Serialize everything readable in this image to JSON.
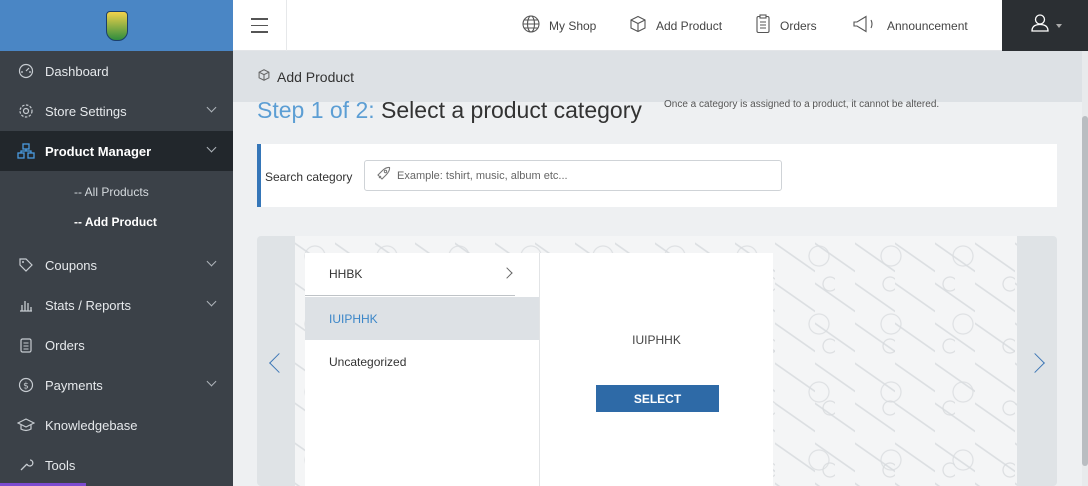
{
  "sidebar": {
    "items": [
      {
        "label": "Dashboard",
        "icon": "dashboard-icon",
        "has_children": false
      },
      {
        "label": "Store Settings",
        "icon": "gear-icon",
        "has_children": true
      },
      {
        "label": "Product Manager",
        "icon": "sitemap-icon",
        "has_children": true,
        "active": true,
        "children": [
          {
            "label": "-- All Products"
          },
          {
            "label": "-- Add Product",
            "current": true
          }
        ]
      },
      {
        "label": "Coupons",
        "icon": "tag-icon",
        "has_children": true
      },
      {
        "label": "Stats / Reports",
        "icon": "bar-chart-icon",
        "has_children": true
      },
      {
        "label": "Orders",
        "icon": "clipboard-icon",
        "has_children": false
      },
      {
        "label": "Payments",
        "icon": "dollar-icon",
        "has_children": true
      },
      {
        "label": "Knowledgebase",
        "icon": "graduation-cap-icon",
        "has_children": false
      },
      {
        "label": "Tools",
        "icon": "wrench-icon",
        "has_children": false
      }
    ]
  },
  "topbar": {
    "links": [
      {
        "label": "My Shop",
        "icon": "globe-icon"
      },
      {
        "label": "Add Product",
        "icon": "cube-icon"
      },
      {
        "label": "Orders",
        "icon": "clipboard-icon"
      },
      {
        "label": "Announcement",
        "icon": "megaphone-icon"
      }
    ]
  },
  "breadcrumb": {
    "label": "Add Product"
  },
  "step": {
    "count": "Step 1 of 2",
    "separator": ":",
    "title": " Select a product category",
    "note": "Once a category is assigned to a product, it cannot be altered."
  },
  "search": {
    "label": "Search category",
    "placeholder": "Example: tshirt, music, album etc..."
  },
  "categories": {
    "items": [
      "HHBK",
      "IUIPHHK",
      "Uncategorized"
    ],
    "selected": "IUIPHHK",
    "detail_name": "IUIPHHK",
    "select_label": "SELECT"
  },
  "colors": {
    "sidebar_bg": "#3b4148",
    "logo_bar": "#4a86c5",
    "accent": "#3576b8",
    "select_button": "#2e6aa7"
  }
}
